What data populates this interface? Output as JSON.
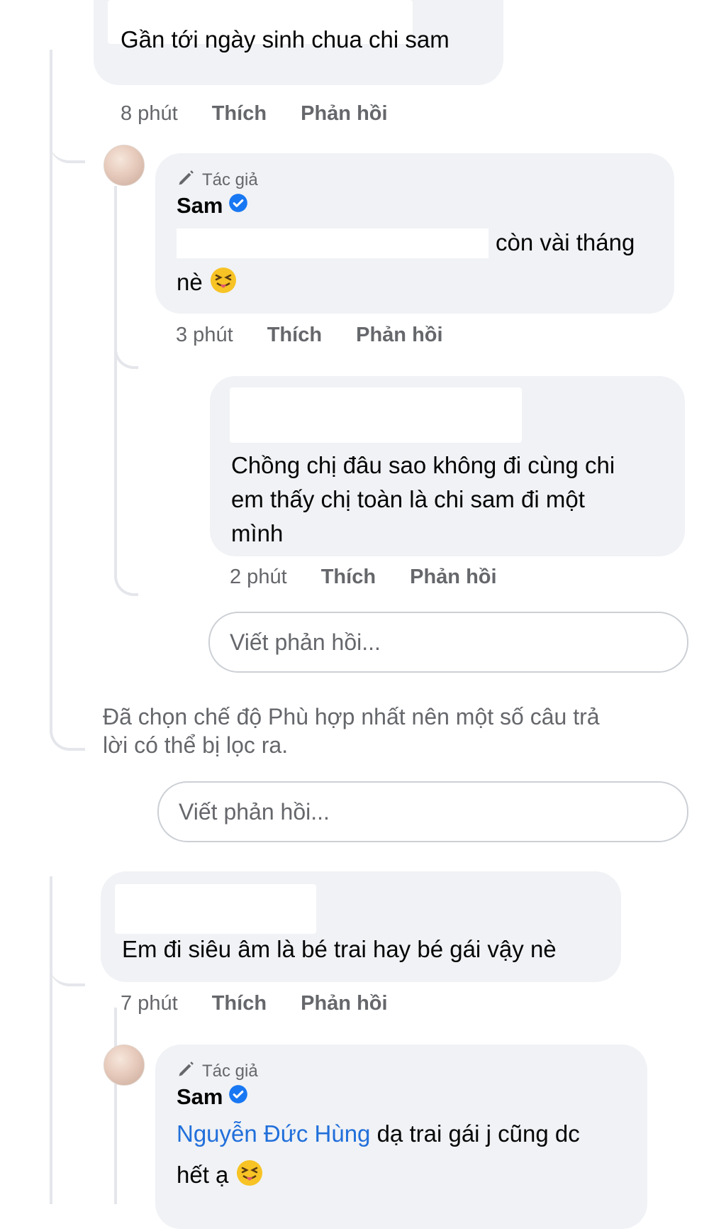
{
  "comments": [
    {
      "text": "Gần tới ngày sinh chua chi sam",
      "time": "8 phút",
      "like": "Thích",
      "reply": "Phản hồi"
    },
    {
      "author_badge": "Tác giả",
      "name": "Sam",
      "text_line1": "còn vài tháng",
      "text_line2": "nè",
      "time": "3 phút",
      "like": "Thích",
      "reply": "Phản hồi"
    },
    {
      "text_line1": "Chồng chị đâu sao không đi cùng chi",
      "text_line2": "em thấy chị toàn là chi sam đi một",
      "text_line3": "mình",
      "time": "2 phút",
      "like": "Thích",
      "reply": "Phản hồi"
    },
    {
      "text": "Em đi siêu âm là bé trai hay bé gái vậy nè",
      "time": "7 phút",
      "like": "Thích",
      "reply": "Phản hồi"
    },
    {
      "author_badge": "Tác giả",
      "name": "Sam",
      "mention": "Nguyễn Đức Hùng",
      "text_line1": "dạ trai gái j cũng dc",
      "text_line2": "hết ạ"
    }
  ],
  "reply_input_placeholder": "Viết phản hồi...",
  "filter_notice_line1": "Đã chọn chế độ Phù hợp nhất nên một số câu trả",
  "filter_notice_line2": "lời có thể bị lọc ra.",
  "colors": {
    "bubble": "#f0f2f5",
    "mention": "#216fdb",
    "verified": "#1877f2",
    "meta": "#65676b"
  },
  "icons": [
    "pencil-icon",
    "verified-badge-icon",
    "squinting-tongue-emoji"
  ]
}
